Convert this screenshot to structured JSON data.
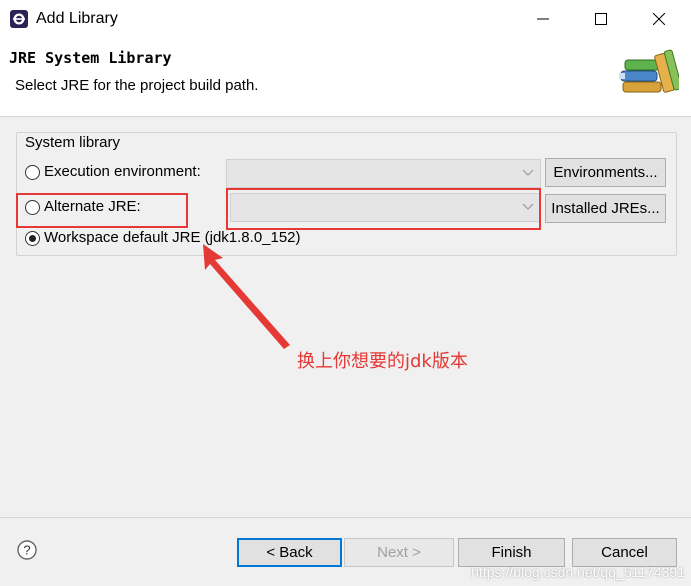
{
  "window": {
    "title": "Add Library"
  },
  "header": {
    "title": "JRE System Library",
    "subtitle": "Select JRE for the project build path."
  },
  "group": {
    "label": "System library"
  },
  "options": {
    "execution_env": {
      "label": "Execution environment:",
      "selected": false,
      "combo_value": "",
      "button": "Environments..."
    },
    "alternate_jre": {
      "label": "Alternate JRE:",
      "selected": false,
      "combo_value": "",
      "button": "Installed JREs..."
    },
    "workspace_default": {
      "label": "Workspace default JRE (jdk1.8.0_152)",
      "selected": true
    }
  },
  "annotation": {
    "text": "换上你想要的jdk版本",
    "color": "#e53935"
  },
  "footer": {
    "back": "< Back",
    "next": "Next >",
    "finish": "Finish",
    "cancel": "Cancel"
  },
  "watermark": "https://blog.csdn.net/qq_51174391"
}
